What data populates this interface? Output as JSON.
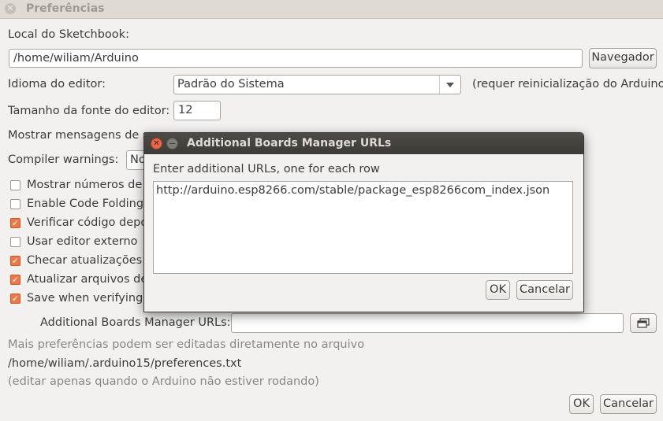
{
  "window": {
    "title": "Preferências"
  },
  "sketchbook": {
    "label": "Local do Sketchbook:",
    "path": "/home/wiliam/Arduino",
    "browse_label": "Navegador"
  },
  "editor_language": {
    "label": "Idioma do editor:",
    "selected": "Padrão do Sistema",
    "note": "(requer reinicialização do Arduino)"
  },
  "font_size": {
    "label": "Tamanho da fonte do editor:",
    "value": "12"
  },
  "verbose": {
    "label": "Mostrar mensagens de sa"
  },
  "compiler_warnings": {
    "label": "Compiler warnings:",
    "selected": "No"
  },
  "checkboxes": [
    {
      "label": "Mostrar números de l",
      "checked": false
    },
    {
      "label": "Enable Code Folding",
      "checked": false
    },
    {
      "label": "Verificar código depo",
      "checked": true
    },
    {
      "label": "Usar editor externo",
      "checked": false
    },
    {
      "label": "Checar atualizações a",
      "checked": true
    },
    {
      "label": "Atualizar arquivos de s",
      "checked": true
    },
    {
      "label": "Save when verifying o",
      "checked": true
    }
  ],
  "boards_urls": {
    "label": "Additional Boards Manager URLs:",
    "value": ""
  },
  "footer": {
    "more_prefs": "Mais preferências podem ser editadas diretamente no arquivo",
    "prefs_path": "/home/wiliam/.arduino15/preferences.txt",
    "edit_note": "(editar apenas quando o Arduino não estiver rodando)",
    "ok_label": "OK",
    "cancel_label": "Cancelar"
  },
  "dialog": {
    "title": "Additional Boards Manager URLs",
    "instruction": "Enter additional URLs, one for each row",
    "urls_text": "http://arduino.esp8266.com/stable/package_esp8266com_index.json",
    "ok_label": "OK",
    "cancel_label": "Cancelar"
  }
}
